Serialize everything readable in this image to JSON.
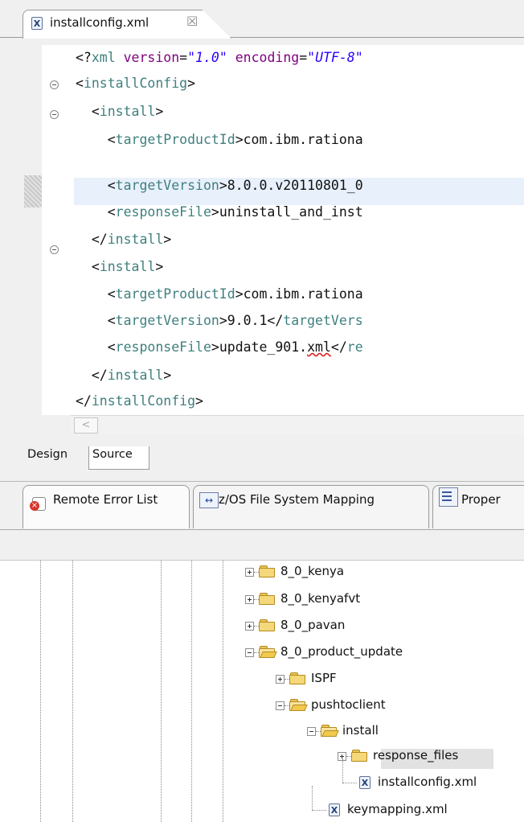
{
  "editor": {
    "tab_title": "installconfig.xml",
    "tab_close_glyph": "☒",
    "file_icon_glyph": "X",
    "code_lines": [
      {
        "parts": [
          [
            "k",
            "<?"
          ],
          [
            "t",
            "xml"
          ],
          [
            "k",
            " "
          ],
          [
            "a",
            "version"
          ],
          [
            "k",
            "="
          ],
          [
            "v",
            "\"1.0\""
          ],
          [
            "k",
            " "
          ],
          [
            "a",
            "encoding"
          ],
          [
            "k",
            "="
          ],
          [
            "v",
            "\"UTF-8\""
          ]
        ]
      },
      {
        "parts": [
          [
            "k",
            "<"
          ],
          [
            "t",
            "installConfig"
          ],
          [
            "k",
            ">"
          ]
        ]
      },
      {
        "parts": [
          [
            "k",
            "  <"
          ],
          [
            "t",
            "install"
          ],
          [
            "k",
            ">"
          ]
        ]
      },
      {
        "parts": [
          [
            "k",
            "    <"
          ],
          [
            "t",
            "targetProductId"
          ],
          [
            "k",
            ">com.ibm.rationa"
          ]
        ]
      },
      {
        "parts": [
          [
            "k",
            "    <"
          ],
          [
            "t",
            "targetVersion"
          ],
          [
            "k",
            ">8.0.0.v20110801_0"
          ]
        ]
      },
      {
        "parts": [
          [
            "k",
            "    <"
          ],
          [
            "t",
            "responseFile"
          ],
          [
            "k",
            ">uninstall_and_inst"
          ]
        ]
      },
      {
        "parts": [
          [
            "k",
            "  </"
          ],
          [
            "t",
            "install"
          ],
          [
            "k",
            ">"
          ]
        ]
      },
      {
        "parts": [
          [
            "k",
            "  <"
          ],
          [
            "t",
            "install"
          ],
          [
            "k",
            ">"
          ]
        ]
      },
      {
        "parts": [
          [
            "k",
            "    <"
          ],
          [
            "t",
            "targetProductId"
          ],
          [
            "k",
            ">com.ibm.rationa"
          ]
        ]
      },
      {
        "parts": [
          [
            "k",
            "    <"
          ],
          [
            "t",
            "targetVersion"
          ],
          [
            "k",
            ">9.0.1</"
          ],
          [
            "t",
            "targetVers"
          ]
        ]
      },
      {
        "parts": [
          [
            "k",
            "    <"
          ],
          [
            "t",
            "responseFile"
          ],
          [
            "k",
            ">update_901."
          ],
          [
            "sq",
            "xml"
          ],
          [
            "k",
            "</"
          ],
          [
            "t",
            "re"
          ]
        ]
      },
      {
        "parts": [
          [
            "k",
            "  </"
          ],
          [
            "t",
            "install"
          ],
          [
            "k",
            ">"
          ]
        ]
      },
      {
        "parts": [
          [
            "k",
            "</"
          ],
          [
            "t",
            "installConfig"
          ],
          [
            "k",
            ">"
          ]
        ]
      }
    ],
    "scroll_left_glyph": "<",
    "bottom_tabs": {
      "design": "Design",
      "source": "Source"
    }
  },
  "views": {
    "tabs": [
      {
        "label": "Remote Error List",
        "icon": "error-list-icon"
      },
      {
        "label": "z/OS File System Mapping",
        "icon": "mapping-icon",
        "glyph": "↔"
      },
      {
        "label": "Proper",
        "icon": "properties-icon"
      }
    ]
  },
  "tree": {
    "items": [
      {
        "label": "8_0_kenya",
        "type": "folder",
        "state": "collapsed"
      },
      {
        "label": "8_0_kenyafvt",
        "type": "folder",
        "state": "collapsed"
      },
      {
        "label": "8_0_pavan",
        "type": "folder",
        "state": "collapsed"
      },
      {
        "label": "8_0_product_update",
        "type": "folder",
        "state": "expanded"
      },
      {
        "label": "ISPF",
        "type": "folder",
        "state": "collapsed"
      },
      {
        "label": "pushtoclient",
        "type": "folder",
        "state": "expanded"
      },
      {
        "label": "install",
        "type": "folder",
        "state": "expanded"
      },
      {
        "label": "response_files",
        "type": "folder",
        "state": "collapsed"
      },
      {
        "label": "installconfig.xml",
        "type": "file",
        "selected": true
      },
      {
        "label": "keymapping.xml",
        "type": "file"
      }
    ]
  }
}
